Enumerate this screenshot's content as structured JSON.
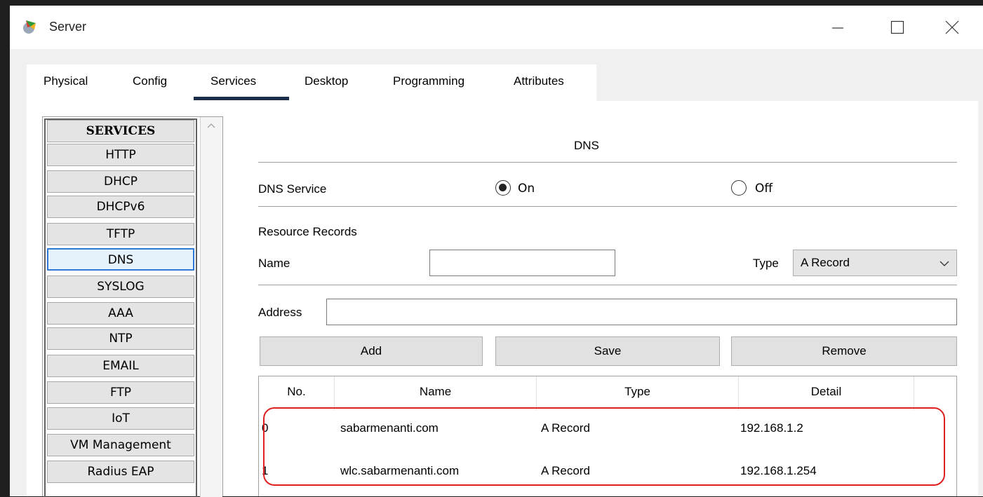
{
  "window": {
    "title": "Server"
  },
  "tabs": [
    "Physical",
    "Config",
    "Services",
    "Desktop",
    "Programming",
    "Attributes"
  ],
  "active_tab": "Services",
  "services": {
    "items": [
      "SERVICES",
      "HTTP",
      "DHCP",
      "DHCPv6",
      "TFTP",
      "DNS",
      "SYSLOG",
      "AAA",
      "NTP",
      "EMAIL",
      "FTP",
      "IoT",
      "VM Management",
      "Radius EAP"
    ],
    "selected": "DNS"
  },
  "dns": {
    "title": "DNS",
    "service_label": "DNS Service",
    "on_label": "On",
    "off_label": "Off",
    "service_state": "On",
    "resource_records_label": "Resource Records",
    "name_label": "Name",
    "name_value": "",
    "type_label": "Type",
    "type_value": "A Record",
    "address_label": "Address",
    "address_value": "",
    "add_label": "Add",
    "save_label": "Save",
    "remove_label": "Remove",
    "table": {
      "columns": [
        "No.",
        "Name",
        "Type",
        "Detail"
      ],
      "rows": [
        {
          "no": "0",
          "name": "sabarmenanti.com",
          "type": "A Record",
          "detail": "192.168.1.2"
        },
        {
          "no": "1",
          "name": "wlc.sabarmenanti.com",
          "type": "A Record",
          "detail": "192.168.1.254"
        }
      ]
    }
  },
  "colors": {
    "highlight": "#e02020",
    "tab_underline": "#1a2e4a",
    "selected_border": "#2f7bd6"
  }
}
